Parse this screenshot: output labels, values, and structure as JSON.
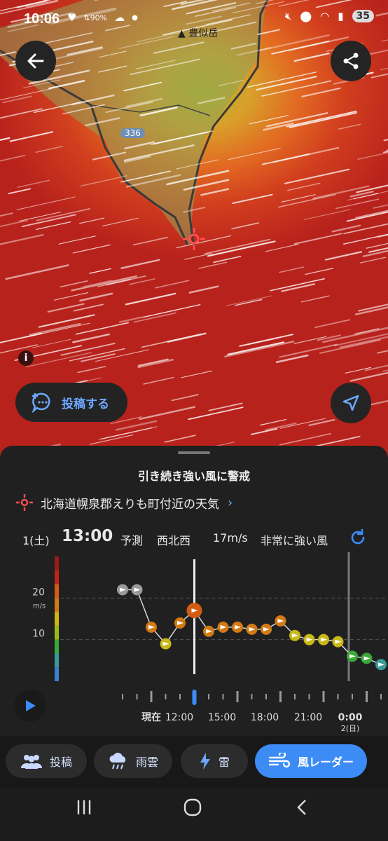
{
  "status_bar": {
    "time": "10:06",
    "signal_pct": "90%",
    "battery": "35"
  },
  "map": {
    "mountain_label": "豊似岳",
    "road_number": "336",
    "info_label": "i",
    "post_button_label": "投稿する",
    "back_icon": "arrow-left-icon",
    "share_icon": "share-icon",
    "locate_icon": "navigation-arrow-icon",
    "wind_colors": {
      "strong": "#b8221c",
      "medium": "#e26a22",
      "light": "#b5b12a"
    }
  },
  "sheet": {
    "headline": "引き続き強い風に警戒",
    "location": "北海道幌泉郡えりも町付近の天気",
    "detail": {
      "date": "1(土)",
      "time": "13:00",
      "type": "予測",
      "direction": "西北西",
      "speed": "17m/s",
      "level": "非常に強い風"
    }
  },
  "chart_data": {
    "type": "line",
    "title": "",
    "ylabel": "m/s",
    "y_ticks": [
      "20",
      "10"
    ],
    "ylim": [
      0,
      30
    ],
    "x_tick_labels": [
      "現在",
      "12:00",
      "15:00",
      "18:00",
      "21:00",
      "0:00",
      "2(日)"
    ],
    "series": [
      {
        "values": [
          22,
          22,
          13,
          9,
          14,
          17,
          12,
          13,
          13,
          12.5,
          12.5,
          14.5,
          11,
          10,
          10,
          9.5,
          6,
          5.5,
          4
        ]
      }
    ],
    "current_index": 5,
    "point_colors": [
      "#9a9a9a",
      "#9a9a9a",
      "#d27a14",
      "#c9b815",
      "#d27a14",
      "#d25c14",
      "#d27a14",
      "#d27a14",
      "#d27a14",
      "#d27a14",
      "#d27a14",
      "#d27a14",
      "#c9b815",
      "#c9b815",
      "#c9b815",
      "#c9b815",
      "#3aa83a",
      "#3aa83a",
      "#3a9a9a"
    ]
  },
  "tabs": [
    {
      "label": "投稿",
      "icon": "people-icon",
      "active": false
    },
    {
      "label": "雨雲",
      "icon": "rain-cloud-icon",
      "active": false
    },
    {
      "label": "雷",
      "icon": "lightning-icon",
      "active": false
    },
    {
      "label": "風レーダー",
      "icon": "wind-icon",
      "active": true
    }
  ]
}
